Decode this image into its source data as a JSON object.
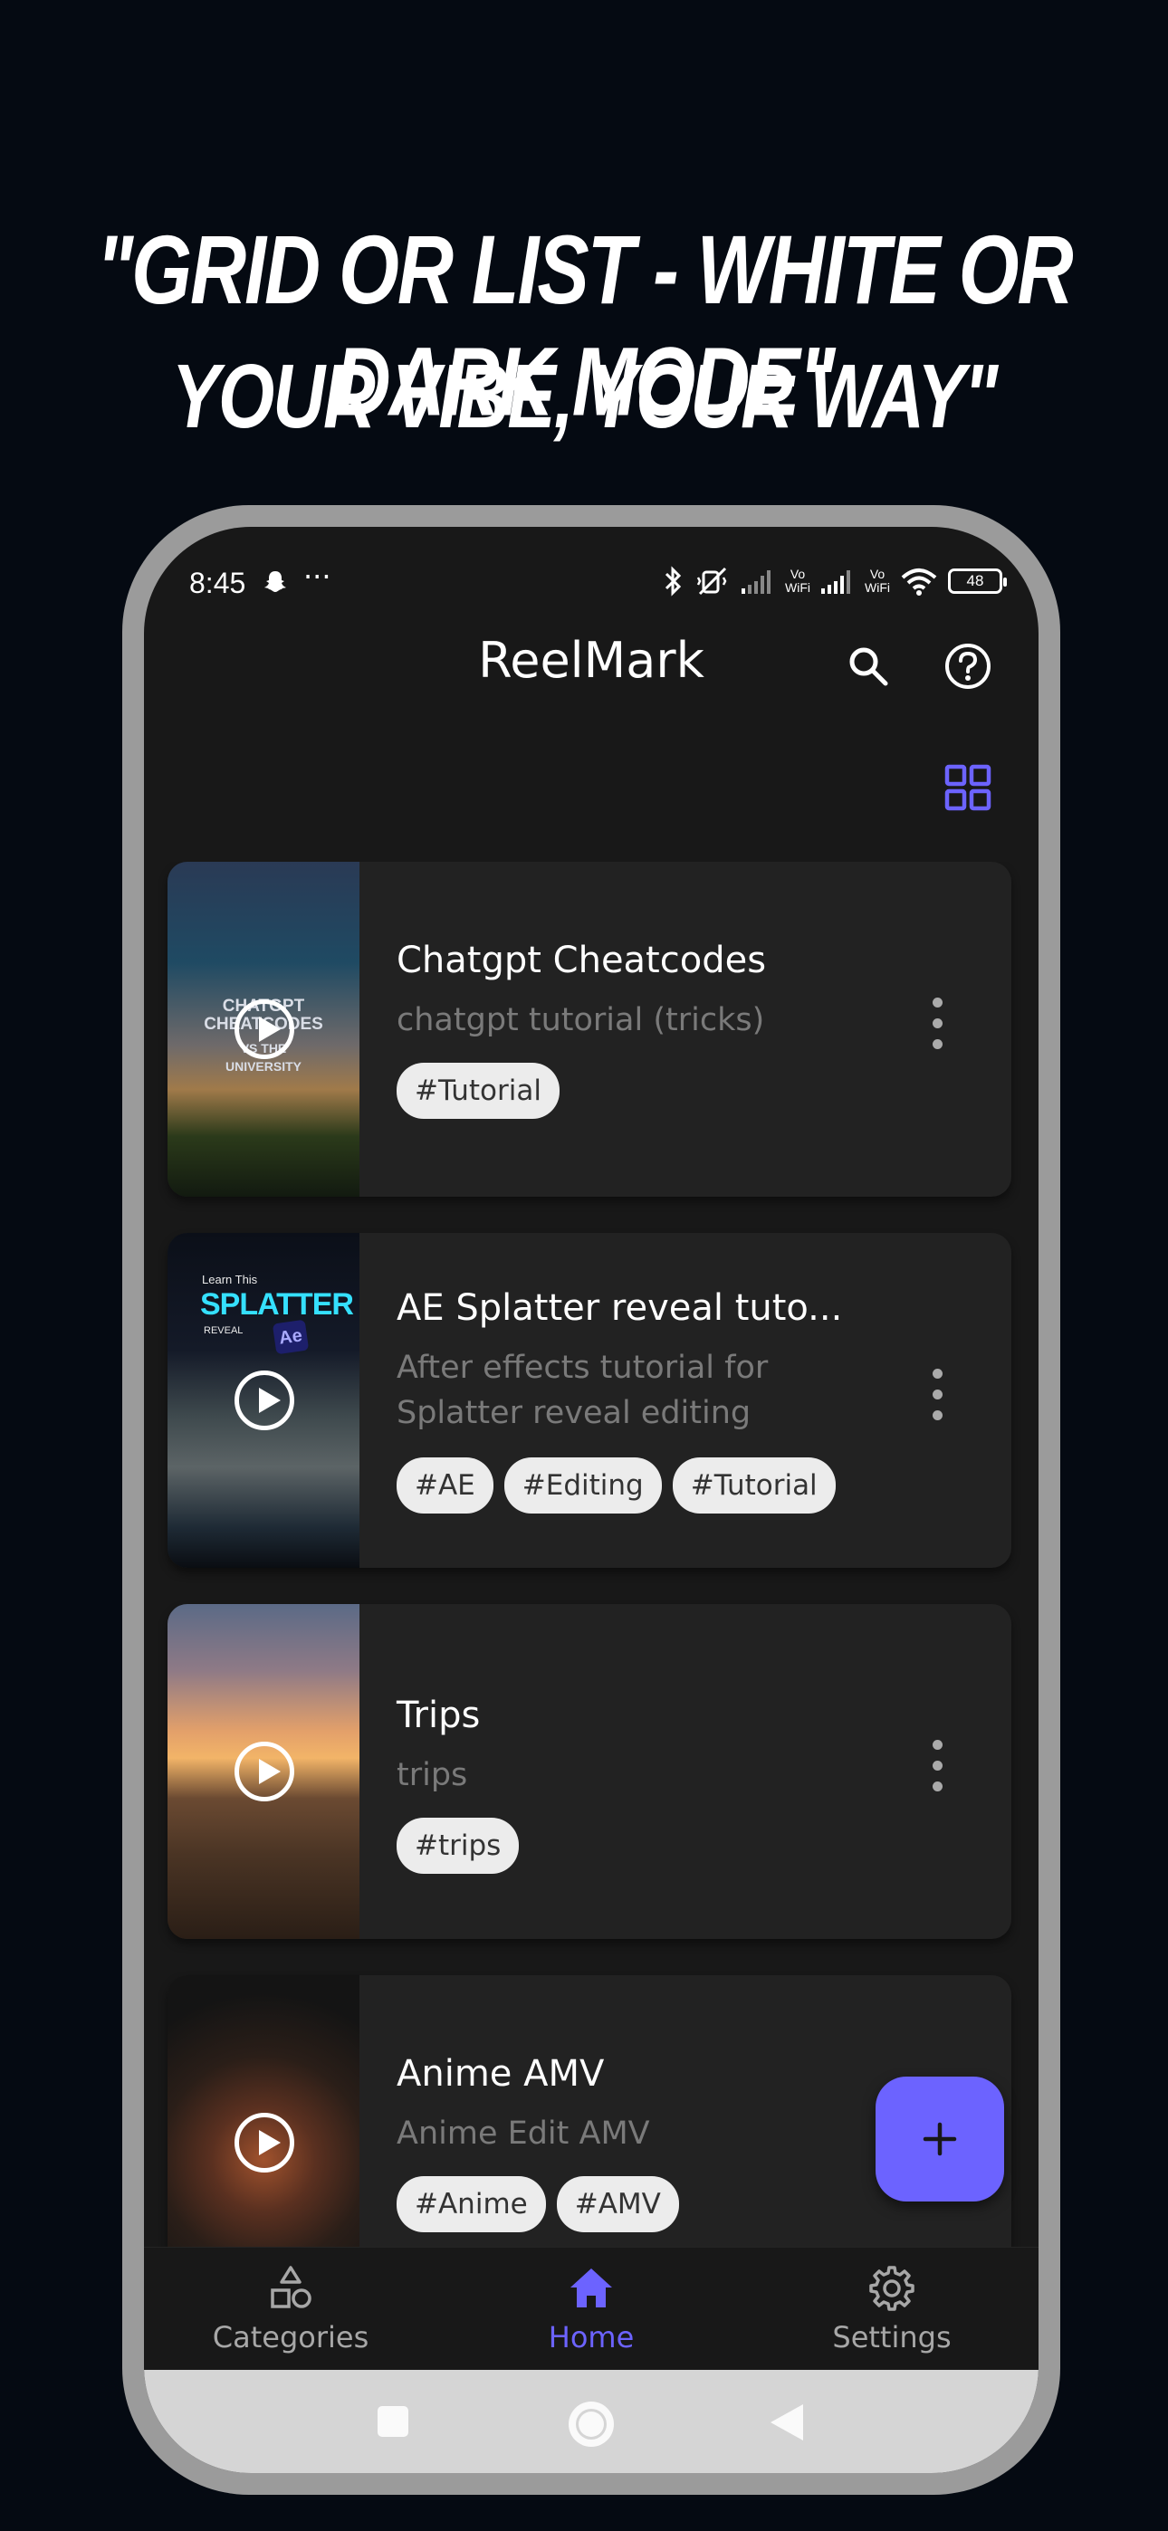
{
  "promo": {
    "line1": "\"Grid or List - White or Dark Mode\"",
    "line2": "Your Vibe, Your Way\""
  },
  "status_bar": {
    "time": "8:45",
    "more": "···",
    "vowifi1": "Vo\nWiFi",
    "vowifi2": "Vo\nWiFi",
    "battery": "48"
  },
  "app_bar": {
    "title": "ReelMark"
  },
  "colors": {
    "accent": "#6c63ff",
    "background": "#181818",
    "card": "#222222"
  },
  "items": [
    {
      "title": "Chatgpt Cheatcodes",
      "description": "chatgpt tutorial (tricks)",
      "tags": [
        "#Tutorial"
      ],
      "thumb_text": [
        "CHATGPT",
        "CHEATCODES",
        "VS THE",
        "UNIVERSITY"
      ]
    },
    {
      "title": "AE Splatter reveal tuto...",
      "description": "After effects tutorial for Splatter reveal editing",
      "tags": [
        "#AE",
        "#Editing",
        "#Tutorial"
      ],
      "thumb_text": [
        "Learn This",
        "SPLATTER",
        "REVEAL",
        "Ae"
      ]
    },
    {
      "title": "Trips",
      "description": "trips",
      "tags": [
        "#trips"
      ]
    },
    {
      "title": "Anime AMV",
      "description": "Anime Edit AMV",
      "tags": [
        "#Anime",
        "#AMV"
      ]
    }
  ],
  "fab": {
    "icon": "plus-icon"
  },
  "bottom_nav": [
    {
      "label": "Categories",
      "icon": "shapes-icon",
      "active": false
    },
    {
      "label": "Home",
      "icon": "home-icon",
      "active": true
    },
    {
      "label": "Settings",
      "icon": "gear-icon",
      "active": false
    }
  ]
}
